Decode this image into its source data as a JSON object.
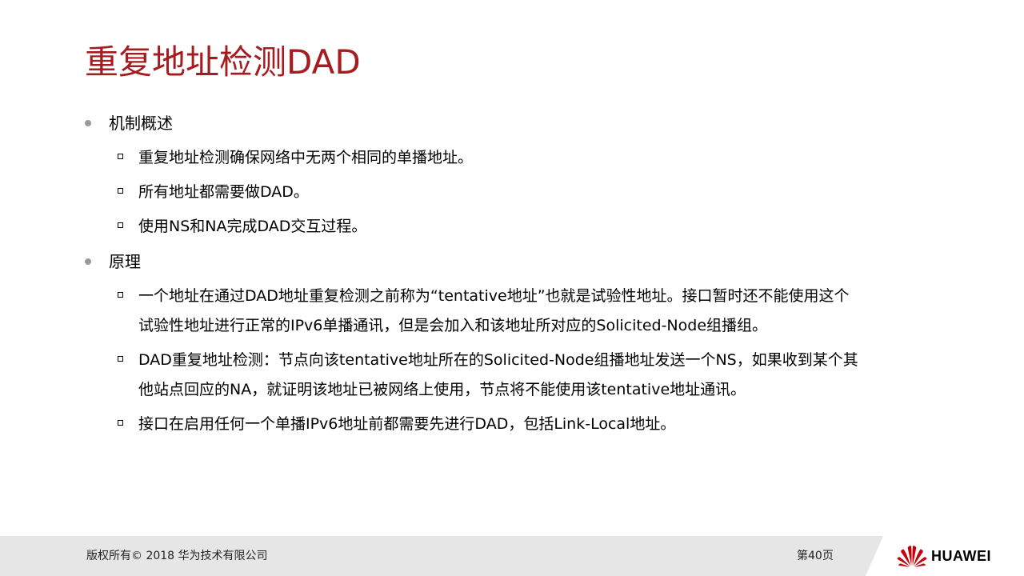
{
  "slide": {
    "title": "重复地址检测DAD"
  },
  "sections": [
    {
      "heading": "机制概述",
      "items": [
        {
          "lines": [
            "重复地址检测确保网络中无两个相同的单播地址。"
          ]
        },
        {
          "lines": [
            "所有地址都需要做DAD。"
          ]
        },
        {
          "lines": [
            "使用NS和NA完成DAD交互过程。"
          ]
        }
      ]
    },
    {
      "heading": "原理",
      "items": [
        {
          "lines": [
            "一个地址在通过DAD地址重复检测之前称为“tentative地址”也就是试验性地址。接口暂时还不能使用这个",
            "试验性地址进行正常的IPv6单播通讯，但是会加入和该地址所对应的Solicited-Node组播组。"
          ]
        },
        {
          "lines": [
            "DAD重复地址检测：节点向该tentative地址所在的Solicited-Node组播地址发送一个NS，如果收到某个其",
            "他站点回应的NA，就证明该地址已被网络上使用，节点将不能使用该tentative地址通讯。"
          ]
        },
        {
          "lines": [
            "接口在启用任何一个单播IPv6地址前都需要先进行DAD，包括Link-Local地址。"
          ]
        }
      ]
    }
  ],
  "footer": {
    "copyright": "版权所有© 2018 华为技术有限公司",
    "page_number": "第40页",
    "brand_name": "HUAWEI"
  },
  "colors": {
    "title": "#a51c20",
    "logo_red": "#c7000b",
    "footer_bg": "#e6e6e6"
  },
  "icons": {
    "level1_bullet": "round-dot-icon",
    "level2_bullet": "hollow-square-icon",
    "logo": "huawei-petal-logo"
  }
}
